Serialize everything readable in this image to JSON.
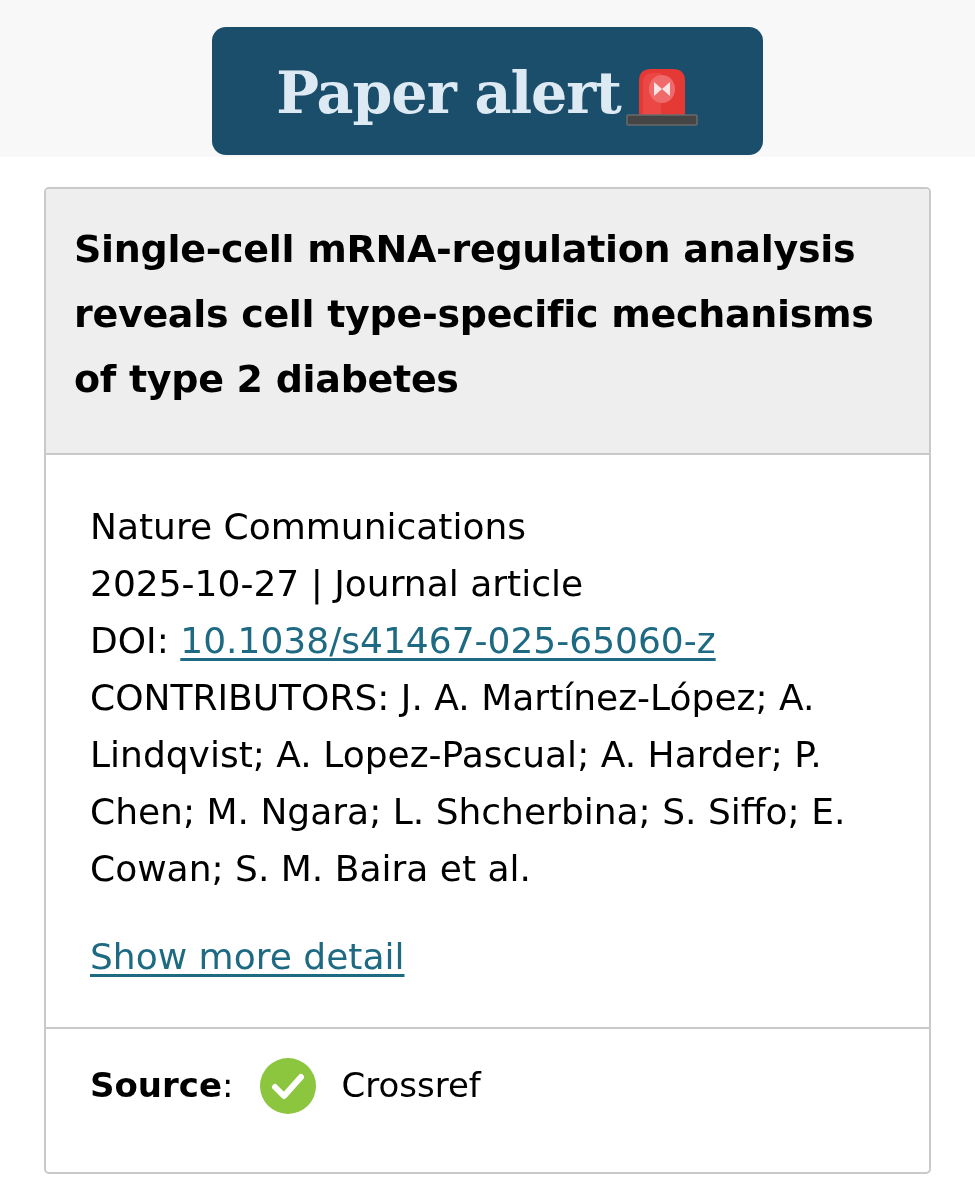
{
  "banner": {
    "title": "Paper alert"
  },
  "article": {
    "title": "Single-cell mRNA-regulation analysis reveals cell type-specific mechanisms of type 2 diabetes",
    "journal": "Nature Communications",
    "date_type": "2025-10-27 | Journal article",
    "doi_label": "DOI:",
    "doi": "10.1038/s41467-025-65060-z",
    "contributors": "CONTRIBUTORS: J. A. Martínez-López; A. Lindqvist; A. Lopez-Pascual; A. Harder; P. Chen; M. Ngara; L. Shcherbina; S. Siffo; E. Cowan; S. M. Baira et al.",
    "show_more": "Show more detail"
  },
  "source": {
    "label": "**Source**:",
    "name": "Crossref"
  }
}
